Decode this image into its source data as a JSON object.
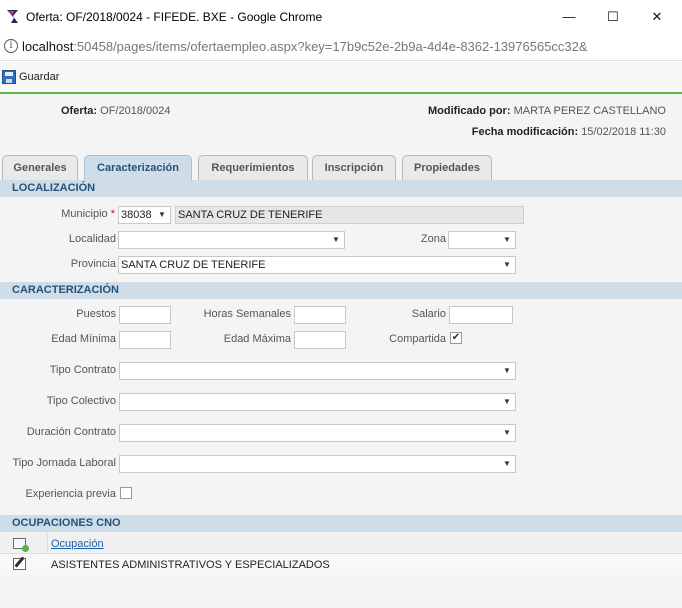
{
  "window": {
    "title": "Oferta: OF/2018/0024 - FIFEDE. BXE - Google Chrome",
    "minimize_glyph": "—",
    "maximize_glyph": "☐",
    "close_glyph": "✕"
  },
  "address_bar": {
    "host": "localhost",
    "path": ":50458/pages/items/ofertaempleo.aspx?key=17b9c52e-2b9a-4d4e-8362-13976565cc32&"
  },
  "toolbar": {
    "save_label": "Guardar"
  },
  "header": {
    "oferta_label": "Oferta:",
    "oferta_value": "OF/2018/0024",
    "modified_by_label": "Modificado por:",
    "modified_by_value": "MARTA PEREZ CASTELLANO",
    "modified_date_label": "Fecha modificación:",
    "modified_date_value": "15/02/2018 11:30"
  },
  "tabs": [
    {
      "label": "Generales"
    },
    {
      "label": "Caracterización"
    },
    {
      "label": "Requerimientos"
    },
    {
      "label": "Inscripción"
    },
    {
      "label": "Propiedades"
    }
  ],
  "localizacion": {
    "title": "LOCALIZACIÓN",
    "municipio_label": "Municipio",
    "required_mark": "*",
    "municipio_code": "38038",
    "municipio_name": "SANTA CRUZ DE TENERIFE",
    "localidad_label": "Localidad",
    "localidad_value": "",
    "zona_label": "Zona",
    "zona_value": "",
    "provincia_label": "Provincia",
    "provincia_value": "SANTA CRUZ DE TENERIFE"
  },
  "caracterizacion": {
    "title": "CARACTERIZACIÓN",
    "puestos_label": "Puestos",
    "horas_label": "Horas Semanales",
    "salario_label": "Salario",
    "edad_min_label": "Edad Mínima",
    "edad_max_label": "Edad Máxima",
    "compartida_label": "Compartida",
    "compartida_checked": true,
    "check_glyph": "✔",
    "tipo_contrato_label": "Tipo Contrato",
    "tipo_colectivo_label": "Tipo Colectivo",
    "duracion_contrato_label": "Duración Contrato",
    "tipo_jornada_label": "Tipo Jornada Laboral",
    "experiencia_label": "Experiencia previa",
    "experiencia_checked": false
  },
  "ocupaciones": {
    "title": "OCUPACIONES CNO",
    "column_header": "Ocupación",
    "rows": [
      {
        "value": "ASISTENTES ADMINISTRATIVOS Y ESPECIALIZADOS"
      }
    ]
  },
  "dropdown_glyph": "▼",
  "colors": {
    "accent_green": "#5bb543",
    "section_bg": "#cfdde9",
    "section_text": "#26527a",
    "required": "#dd1111"
  }
}
